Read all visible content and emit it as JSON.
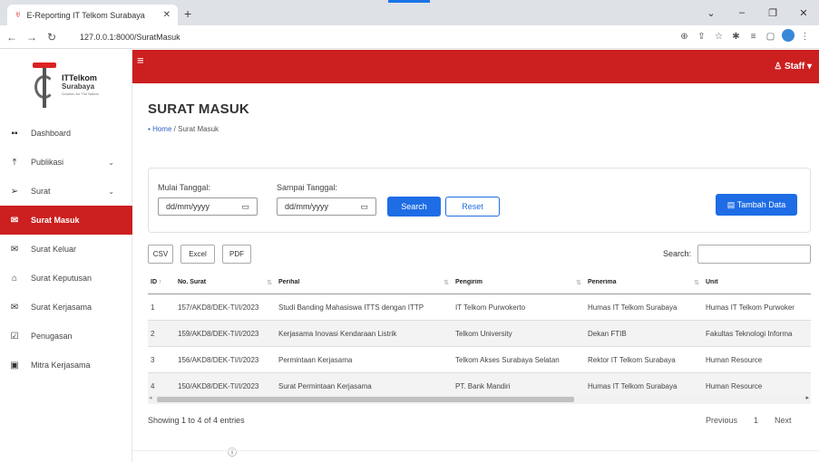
{
  "browser": {
    "tab_title": "E-Reporting IT Telkom Surabaya",
    "url": "127.0.0.1:8000/SuratMasuk",
    "icons": [
      "back-icon",
      "forward-icon",
      "reload-icon",
      "info-icon",
      "zoom-icon",
      "share-icon",
      "star-icon",
      "extension-icon",
      "reading-list-icon",
      "sidepanel-icon",
      "profile-icon",
      "menu-icon"
    ]
  },
  "logo": {
    "name": "ITTelkom",
    "city": "Surabaya",
    "tagline": "Solution for The Nation"
  },
  "sidebar": {
    "items": [
      {
        "label": "Dashboard",
        "icon": "grid-icon"
      },
      {
        "label": "Publikasi",
        "icon": "upload-icon",
        "chevron": "⌄"
      },
      {
        "label": "Surat",
        "icon": "send-icon",
        "chevron": "⌄"
      },
      {
        "label": "Surat Masuk",
        "icon": "mail-icon",
        "active": true
      },
      {
        "label": "Surat Keluar",
        "icon": "mail-out-icon"
      },
      {
        "label": "Surat Keputusan",
        "icon": "mail-open-icon"
      },
      {
        "label": "Surat Kerjasama",
        "icon": "mail-icon"
      },
      {
        "label": "Penugasan",
        "icon": "clipboard-icon"
      },
      {
        "label": "Mitra Kerjasama",
        "icon": "id-card-icon"
      }
    ]
  },
  "topnav": {
    "user_label": "Staff",
    "accent_color": "#cc1f1f"
  },
  "page": {
    "title": "SURAT MASUK",
    "breadcrumb_home": "Home",
    "breadcrumb_sep": " / ",
    "breadcrumb_current": "Surat Masuk"
  },
  "filter": {
    "start_label": "Mulai Tanggal:",
    "start_placeholder": "dd/mm/yyyy",
    "end_label": "Sampai Tanggal:",
    "end_placeholder": "dd/mm/yyyy",
    "search_label": "Search",
    "reset_label": "Reset",
    "add_label": "Tambah Data"
  },
  "table_tools": {
    "csv": "CSV",
    "excel": "Excel",
    "pdf": "PDF",
    "search_label": "Search:"
  },
  "table": {
    "columns": [
      "ID",
      "No. Surat",
      "Perihal",
      "Pengirim",
      "Penerima",
      "Unit"
    ],
    "rows": [
      [
        "1",
        "157/AKD8/DEK-TI/I/2023",
        "Studi Banding Mahasiswa ITTS dengan ITTP",
        "IT Telkom Purwokerto",
        "Humas IT Telkom Surabaya",
        "Humas IT Telkom Purwoker"
      ],
      [
        "2",
        "159/AKD8/DEK-TI/I/2023",
        "Kerjasama Inovasi Kendaraan Listrik",
        "Telkom University",
        "Dekan FTIB",
        "Fakultas Teknologi Informa"
      ],
      [
        "3",
        "156/AKD8/DEK-TI/I/2023",
        "Permintaan Kerjasama",
        "Telkom Akses Surabaya Selatan",
        "Rektor IT Telkom Surabaya",
        "Human Resource"
      ],
      [
        "4",
        "150/AKD8/DEK-TI/I/2023",
        "Surat Permintaan Kerjasama",
        "PT. Bank Mandiri",
        "Humas IT Telkom Surabaya",
        "Human Resource"
      ]
    ]
  },
  "footer": {
    "info": "Showing 1 to 4 of 4 entries",
    "previous": "Previous",
    "page": "1",
    "next": "Next"
  }
}
